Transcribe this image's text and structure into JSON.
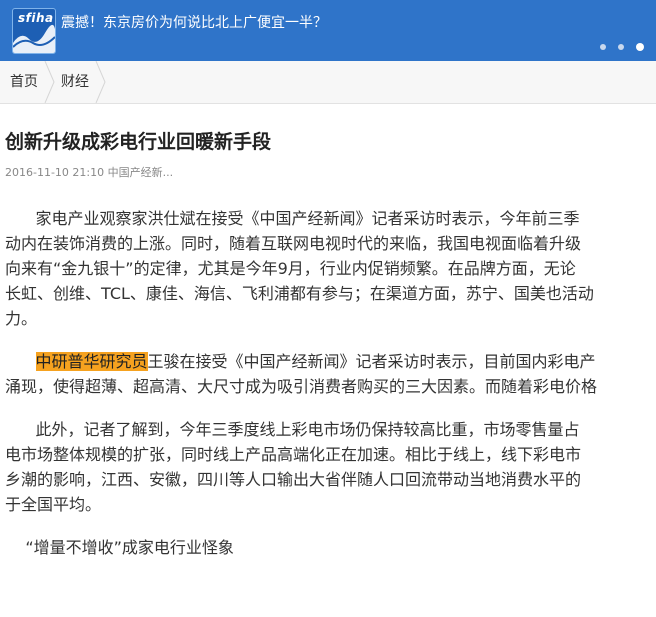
{
  "banner": {
    "logo_text": "sfiha",
    "headline": "震撼！东京房价为何说比北上广便宜一半？",
    "slide_count": 3,
    "active_slide": 3
  },
  "breadcrumb": {
    "home": "首页",
    "category": "财经"
  },
  "article": {
    "title": "创新升级成彩电行业回暖新手段",
    "meta": "2016-11-10 21:10 中国产经新...",
    "paragraph1_lines": [
      "      家电产业观察家洪仕斌在接受《中国产经新闻》记者采访时表示，今年前三季",
      "动内在装饰消费的上涨。同时，随着互联网电视时代的来临，我国电视面临着升级",
      "向来有“金九银十”的定律，尤其是今年9月，行业内促销频繁。在品牌方面，无论",
      "长虹、创维、TCL、康佳、海信、飞利浦都有参与；在渠道方面，苏宁、国美也活动",
      "力。"
    ],
    "paragraph2_indent": "      ",
    "paragraph2_highlight": "中研普华研究员",
    "paragraph2_line1_rest": "王骏在接受《中国产经新闻》记者采访时表示，目前国内彩电产",
    "paragraph2_line2": "涌现，使得超薄、超高清、大尺寸成为吸引消费者购买的三大因素。而随着彩电价格",
    "paragraph3_lines": [
      "      此外，记者了解到，今年三季度线上彩电市场仍保持较高比重，市场零售量占",
      "电市场整体规模的扩张，同时线上产品高端化正在加速。相比于线上，线下彩电市",
      "乡潮的影响，江西、安徽，四川等人口输出大省伴随人口回流带动当地消费水平的",
      "于全国平均。"
    ],
    "subheading": "“增量不增收”成家电行业怪象"
  },
  "colors": {
    "banner_bg": "#2f74c9",
    "highlight": "#f6a21f"
  }
}
